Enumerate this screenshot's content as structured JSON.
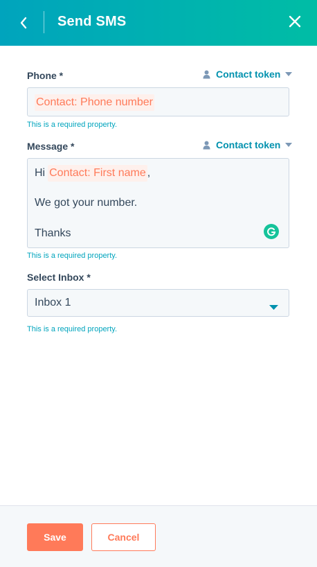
{
  "header": {
    "title": "Send SMS",
    "back_icon": "chevron-left-icon",
    "close_icon": "close-icon",
    "gradient_start": "#00a4bd",
    "gradient_end": "#00bda5"
  },
  "phone": {
    "label": "Phone *",
    "token_link": "Contact token",
    "token_value": "Contact: Phone number",
    "hint": "This is a required property."
  },
  "message": {
    "label": "Message *",
    "token_link": "Contact token",
    "greeting": "Hi",
    "token_value": "Contact: First name",
    "greeting_suffix": ",",
    "line2": "We got your number.",
    "line3": "Thanks",
    "hint": "This is a required property."
  },
  "inbox": {
    "label": "Select Inbox *",
    "selected": "Inbox 1",
    "hint": "This is a required property."
  },
  "footer": {
    "save_label": "Save",
    "cancel_label": "Cancel"
  },
  "colors": {
    "accent": "#ff7a59",
    "link": "#0091ae",
    "hint": "#00a4bd",
    "text": "#33475b"
  }
}
